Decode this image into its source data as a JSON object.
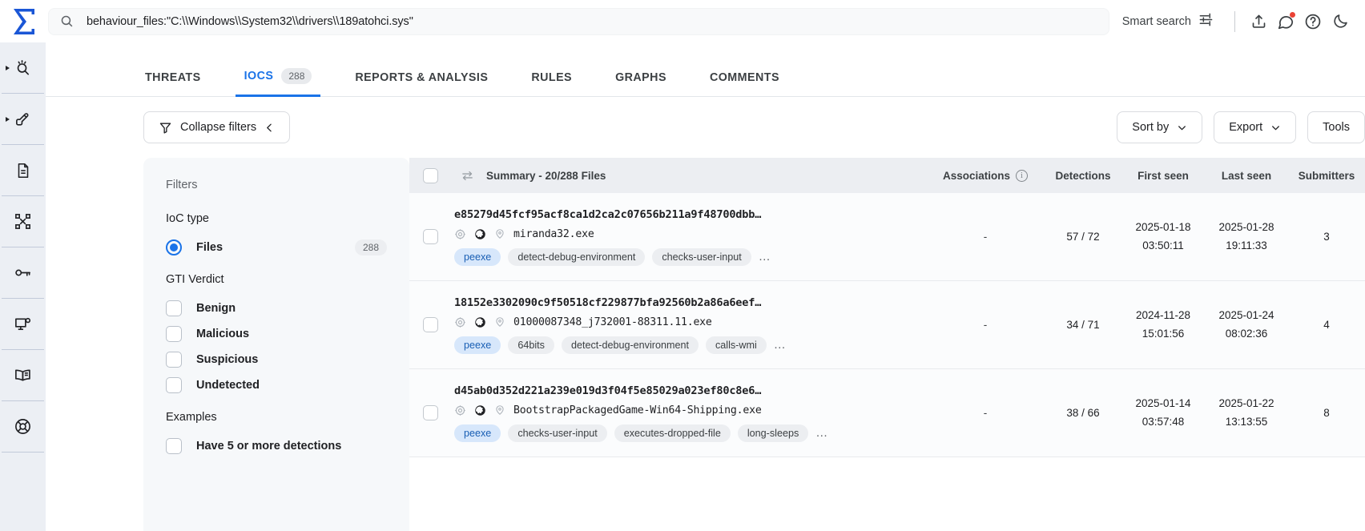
{
  "header": {
    "logo": "sigma-logo",
    "search": {
      "value": "behaviour_files:\"C:\\\\Windows\\\\System32\\\\drivers\\\\189atohci.sys\"",
      "placeholder": "Search"
    },
    "smart_search_label": "Smart search",
    "icons": [
      "search-icon",
      "sliders-icon",
      "upload-icon",
      "comment-icon",
      "help-icon",
      "dark-mode-icon"
    ]
  },
  "rail": {
    "items": [
      {
        "name": "search-explore",
        "icon": "magnifier-spark-icon",
        "expandable": true
      },
      {
        "name": "hunting",
        "icon": "hand-pen-icon",
        "expandable": true
      },
      {
        "name": "reports",
        "icon": "document-icon",
        "expandable": false
      },
      {
        "name": "graph",
        "icon": "nodes-icon",
        "expandable": false
      },
      {
        "name": "api-keys",
        "icon": "key-icon",
        "expandable": false
      },
      {
        "name": "monitor",
        "icon": "monitor-gear-icon",
        "expandable": false
      },
      {
        "name": "knowledge",
        "icon": "book-icon",
        "expandable": false
      },
      {
        "name": "support",
        "icon": "lifebuoy-icon",
        "expandable": false
      }
    ]
  },
  "tabs": [
    {
      "label": "THREATS",
      "badge": null,
      "active": false
    },
    {
      "label": "IOCS",
      "badge": "288",
      "active": true
    },
    {
      "label": "REPORTS & ANALYSIS",
      "badge": null,
      "active": false
    },
    {
      "label": "RULES",
      "badge": null,
      "active": false
    },
    {
      "label": "GRAPHS",
      "badge": null,
      "active": false
    },
    {
      "label": "COMMENTS",
      "badge": null,
      "active": false
    }
  ],
  "toolbar": {
    "collapse_filters_label": "Collapse filters",
    "sort_by_label": "Sort by",
    "export_label": "Export",
    "tools_label": "Tools"
  },
  "filters": {
    "title": "Filters",
    "ioc_type": {
      "label": "IoC type",
      "options": [
        {
          "label": "Files",
          "count": "288",
          "selected": true
        }
      ]
    },
    "gti_verdict": {
      "label": "GTI Verdict",
      "options": [
        {
          "label": "Benign",
          "selected": false
        },
        {
          "label": "Malicious",
          "selected": false
        },
        {
          "label": "Suspicious",
          "selected": false
        },
        {
          "label": "Undetected",
          "selected": false
        }
      ]
    },
    "examples": {
      "label": "Examples",
      "options": [
        {
          "label": "Have 5 or more detections",
          "selected": false
        }
      ]
    }
  },
  "table": {
    "summary_header": "Summary - 20/288 Files",
    "columns": {
      "associations": "Associations",
      "detections": "Detections",
      "first_seen": "First seen",
      "last_seen": "Last seen",
      "submitters": "Submitters"
    },
    "rows": [
      {
        "hash": "e85279d45fcf95acf8ca1d2ca2c07656b211a9f48700dbb…",
        "filename": "miranda32.exe",
        "tags": [
          {
            "label": "peexe",
            "highlight": true
          },
          {
            "label": "detect-debug-environment",
            "highlight": false
          },
          {
            "label": "checks-user-input",
            "highlight": false
          }
        ],
        "more_tags": "…",
        "associations": "-",
        "detections": "57 / 72",
        "first_seen_date": "2025-01-18",
        "first_seen_time": "03:50:11",
        "last_seen_date": "2025-01-28",
        "last_seen_time": "19:11:33",
        "submitters": "3"
      },
      {
        "hash": "18152e3302090c9f50518cf229877bfa92560b2a86a6eef…",
        "filename": "01000087348_j732001-88311.11.exe",
        "tags": [
          {
            "label": "peexe",
            "highlight": true
          },
          {
            "label": "64bits",
            "highlight": false
          },
          {
            "label": "detect-debug-environment",
            "highlight": false
          },
          {
            "label": "calls-wmi",
            "highlight": false
          }
        ],
        "more_tags": "…",
        "associations": "-",
        "detections": "34 / 71",
        "first_seen_date": "2024-11-28",
        "first_seen_time": "15:01:56",
        "last_seen_date": "2025-01-24",
        "last_seen_time": "08:02:36",
        "submitters": "4"
      },
      {
        "hash": "d45ab0d352d221a239e019d3f04f5e85029a023ef80c8e6…",
        "filename": "BootstrapPackagedGame-Win64-Shipping.exe",
        "tags": [
          {
            "label": "peexe",
            "highlight": true
          },
          {
            "label": "checks-user-input",
            "highlight": false
          },
          {
            "label": "executes-dropped-file",
            "highlight": false
          },
          {
            "label": "long-sleeps",
            "highlight": false
          }
        ],
        "more_tags": "…",
        "associations": "-",
        "detections": "38 / 66",
        "first_seen_date": "2025-01-14",
        "first_seen_time": "03:57:48",
        "last_seen_date": "2025-01-22",
        "last_seen_time": "13:13:55",
        "submitters": "8"
      }
    ]
  },
  "colors": {
    "accent": "#1a73e8",
    "rail_bg": "#eceff4",
    "header_bg": "#eceef2",
    "tag_highlight_bg": "#d7e7fb",
    "notification": "#ea4335"
  }
}
